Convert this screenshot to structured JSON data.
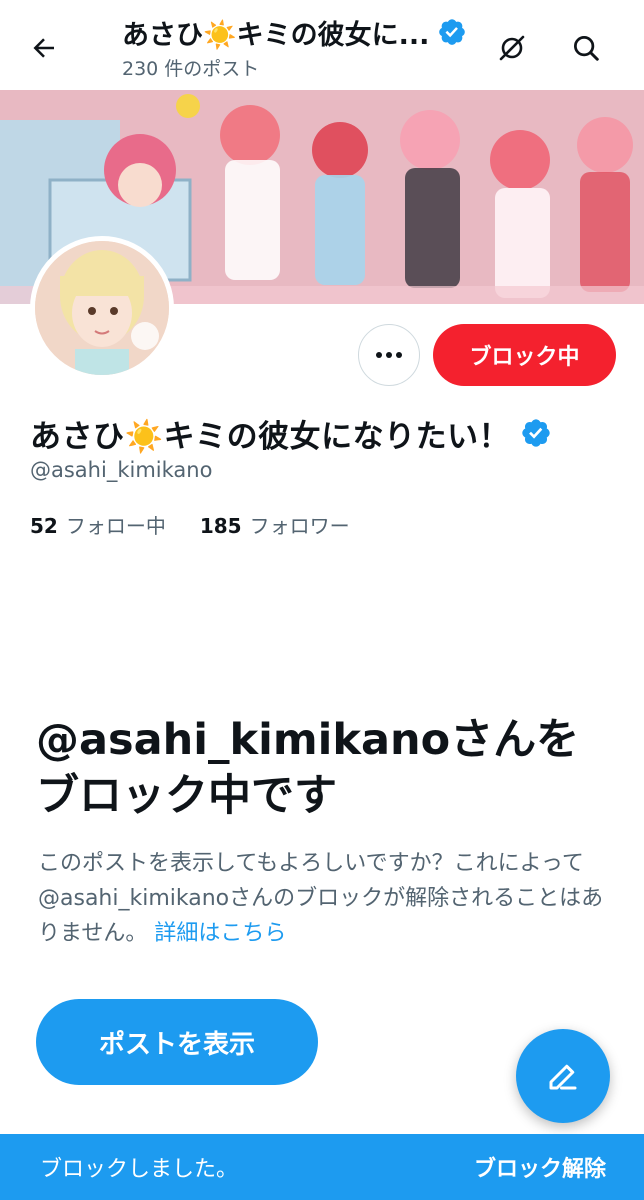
{
  "header": {
    "title": "あさひ☀️キミの彼女に...",
    "post_count": "230 件のポスト"
  },
  "profile": {
    "display_name": "あさひ☀️キミの彼女になりたい！",
    "handle": "@asahi_kimikano",
    "following_count": "52",
    "following_label": "フォロー中",
    "followers_count": "185",
    "followers_label": "フォロワー",
    "block_button_label": "ブロック中"
  },
  "blocked_notice": {
    "title": "@asahi_kimikanoさんをブロック中です",
    "description": "このポストを表示してもよろしいですか？これによって@asahi_kimikanoさんのブロックが解除されることはありません。",
    "learn_more": "詳細はこちら",
    "show_posts_label": "ポストを表示"
  },
  "snackbar": {
    "message": "ブロックしました。",
    "action": "ブロック解除"
  },
  "icons": {
    "back": "arrow-left-icon",
    "verified": "verified-badge-icon",
    "grok": "grok-icon",
    "search": "search-icon",
    "more": "more-horizontal-icon",
    "compose": "compose-icon"
  },
  "colors": {
    "accent": "#1d9bf0",
    "block_red": "#f4212e",
    "secondary_text": "#536471"
  }
}
